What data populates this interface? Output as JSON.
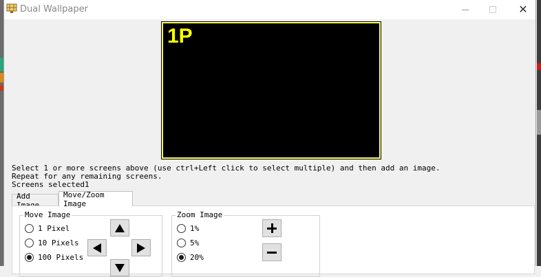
{
  "window": {
    "title": "Dual Wallpaper",
    "close_glyph": "✕"
  },
  "preview": {
    "screen_label": "1P",
    "frame_color": "#ffff66",
    "label_color": "#ffff00"
  },
  "messages": {
    "line1": "Select 1 or more screens above (use ctrl+Left click to select multiple) and then add an image.",
    "line2": "Repeat for any remaining screens.",
    "line3": "Screens selected1"
  },
  "tabs": [
    {
      "label": "Add Image",
      "active": false
    },
    {
      "label": "Move/Zoom Image",
      "active": true
    }
  ],
  "move_group": {
    "title": "Move Image",
    "options": [
      {
        "label": "1 Pixel",
        "checked": false
      },
      {
        "label": "10 Pixels",
        "checked": false
      },
      {
        "label": "100 Pixels",
        "checked": true
      }
    ],
    "buttons": [
      "arrow-up-icon",
      "arrow-left-icon",
      "arrow-right-icon",
      "arrow-down-icon"
    ]
  },
  "zoom_group": {
    "title": "Zoom Image",
    "options": [
      {
        "label": "1%",
        "checked": false
      },
      {
        "label": "5%",
        "checked": false
      },
      {
        "label": "20%",
        "checked": true
      }
    ],
    "buttons": [
      "plus-icon",
      "minus-icon"
    ]
  }
}
